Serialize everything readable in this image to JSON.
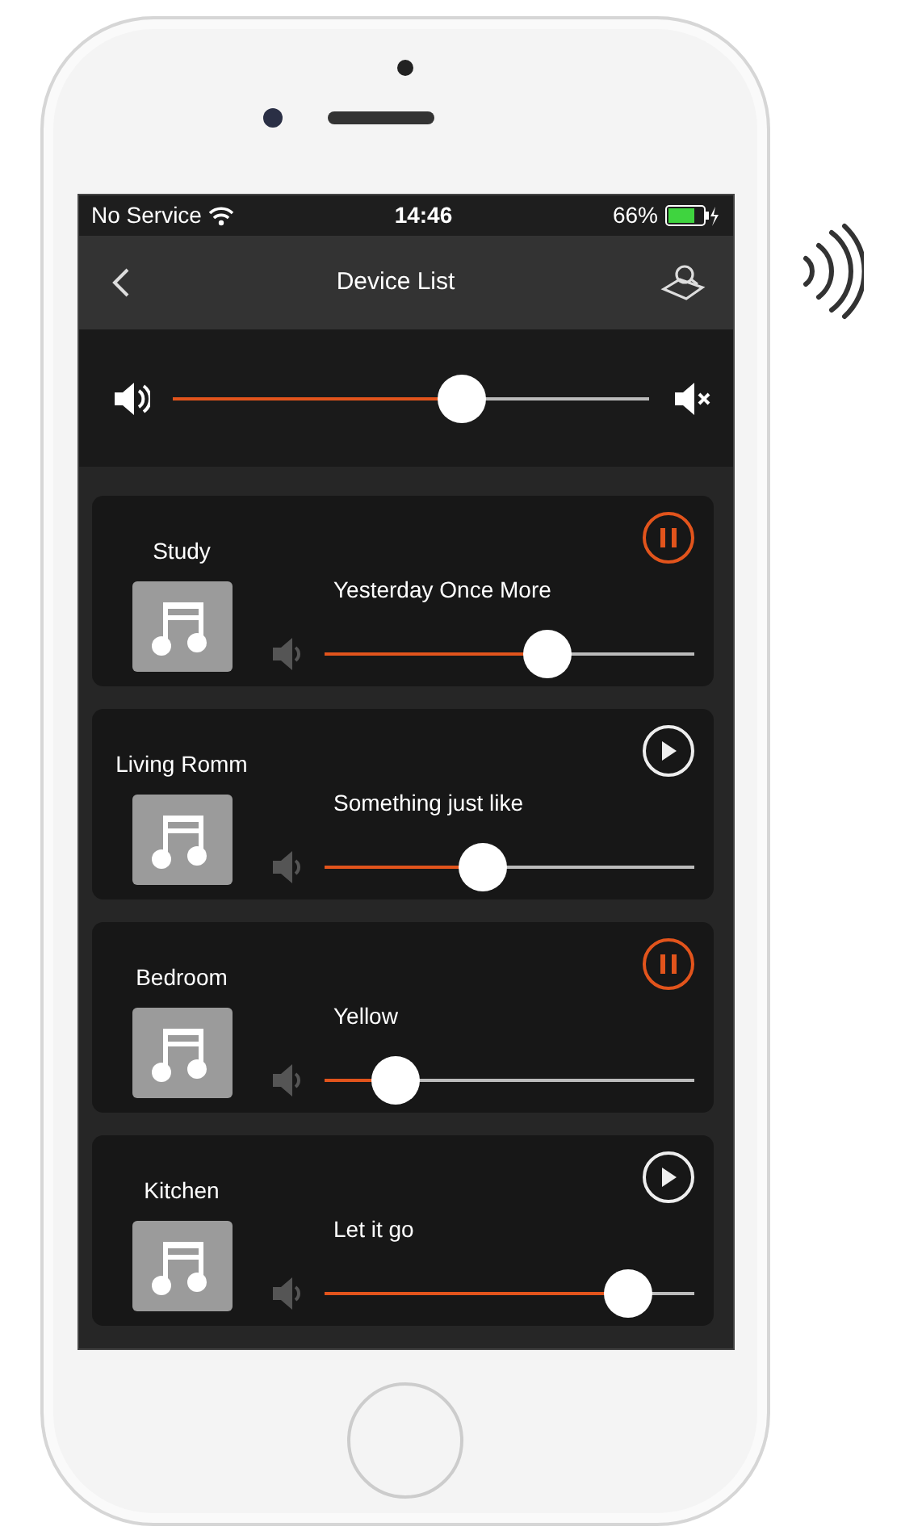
{
  "status_bar": {
    "carrier": "No Service",
    "time": "14:46",
    "battery": "66%"
  },
  "nav_bar": {
    "title": "Device List"
  },
  "master_volume": {
    "level": 0.62
  },
  "devices": [
    {
      "name": "Study",
      "song": "Yesterday Once More",
      "playing": true,
      "level": 0.62
    },
    {
      "name": "Living Romm",
      "song": "Something just like",
      "playing": false,
      "level": 0.42
    },
    {
      "name": "Bedroom",
      "song": "Yellow",
      "playing": true,
      "level": 0.15
    },
    {
      "name": "Kitchen",
      "song": "Let it go",
      "playing": false,
      "level": 0.87
    }
  ]
}
